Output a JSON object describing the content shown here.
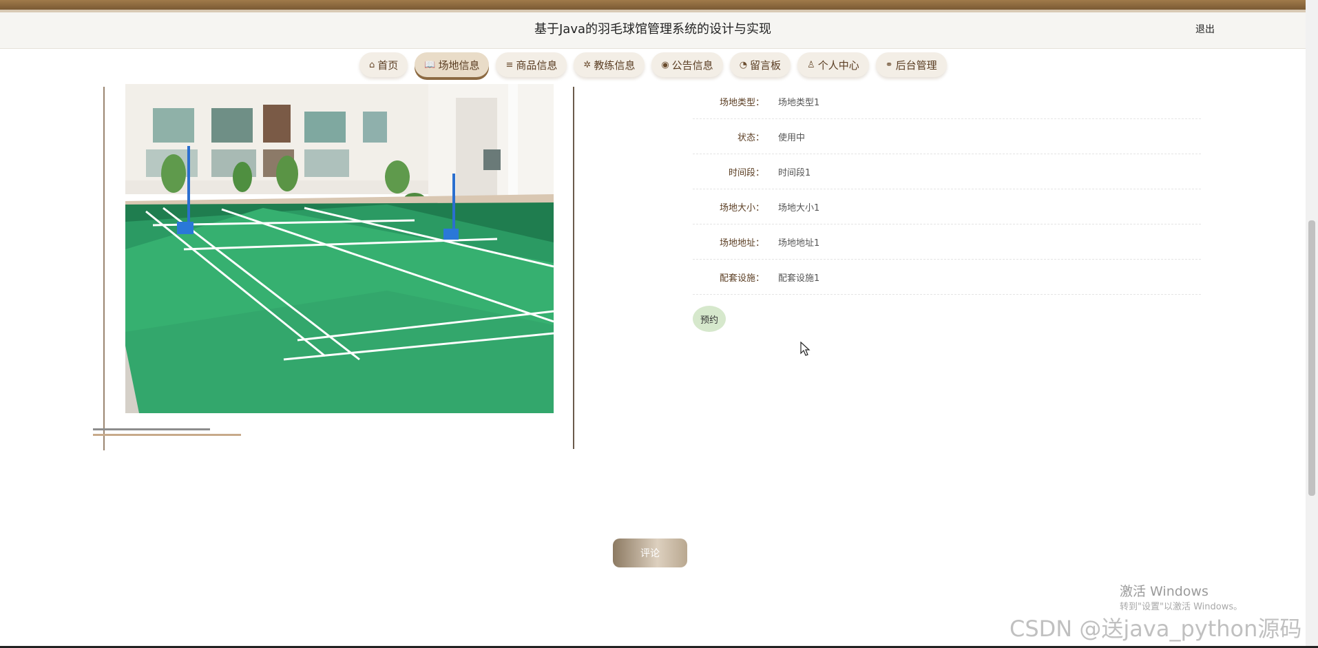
{
  "header": {
    "title": "基于Java的羽毛球馆管理系统的设计与实现",
    "logout": "退出"
  },
  "nav": [
    {
      "label": "首页",
      "icon": "home-icon",
      "glyph": "⌂"
    },
    {
      "label": "场地信息",
      "icon": "book-icon",
      "glyph": "📖"
    },
    {
      "label": "商品信息",
      "icon": "layers-icon",
      "glyph": "≡"
    },
    {
      "label": "教练信息",
      "icon": "gear-icon",
      "glyph": "✲"
    },
    {
      "label": "公告信息",
      "icon": "palette-icon",
      "glyph": "◉"
    },
    {
      "label": "留言板",
      "icon": "dashboard-icon",
      "glyph": "◔"
    },
    {
      "label": "个人中心",
      "icon": "user-icon",
      "glyph": "♙"
    },
    {
      "label": "后台管理",
      "icon": "link-icon",
      "glyph": "⚭"
    }
  ],
  "active_nav": "场地信息",
  "info": [
    {
      "label": "场地类型：",
      "value": "场地类型1"
    },
    {
      "label": "状态：",
      "value": "使用中"
    },
    {
      "label": "时间段：",
      "value": "时间段1"
    },
    {
      "label": "场地大小：",
      "value": "场地大小1"
    },
    {
      "label": "场地地址：",
      "value": "场地地址1"
    },
    {
      "label": "配套设施：",
      "value": "配套设施1"
    }
  ],
  "reserve_label": "预约",
  "comment_label": "评论",
  "carousel": {
    "slides": 3,
    "current": 1
  },
  "system": {
    "activate_title": "激活 Windows",
    "activate_sub": "转到\"设置\"以激活 Windows。",
    "watermark": "CSDN @送java_python源码"
  },
  "colors": {
    "accent": "#8c6a42",
    "court_green": "#2f9a63",
    "reserve_bg": "#d6e8cc"
  }
}
